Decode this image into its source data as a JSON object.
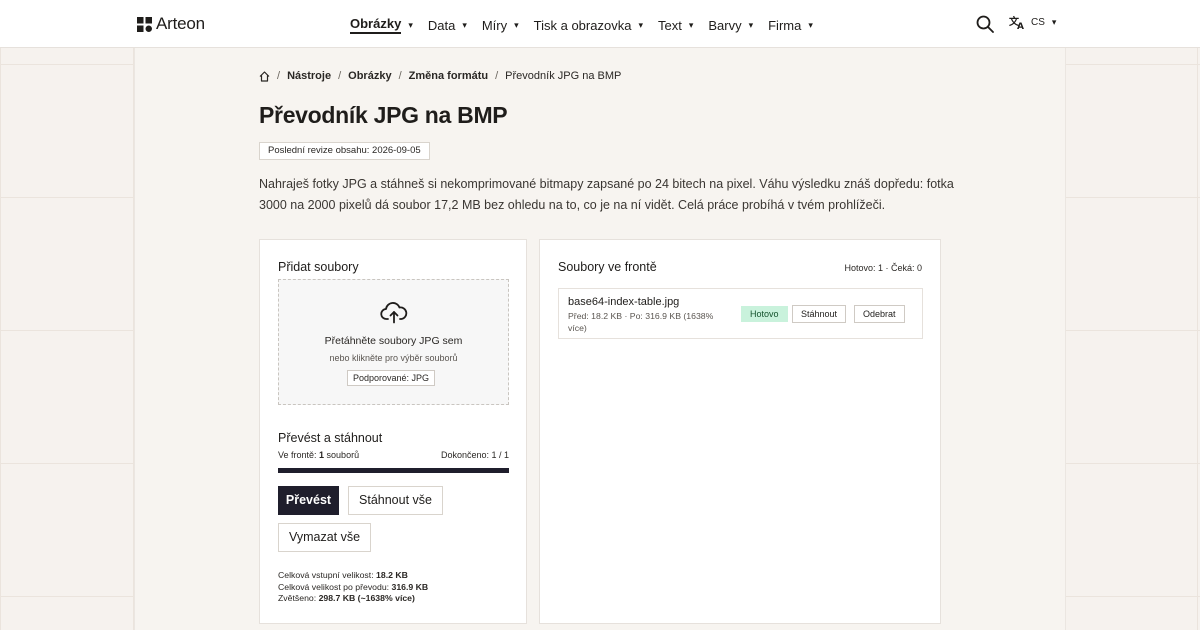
{
  "header": {
    "brand": "Arteon",
    "nav": [
      {
        "label": "Obrázky",
        "active": true
      },
      {
        "label": "Data"
      },
      {
        "label": "Míry"
      },
      {
        "label": "Tisk a obrazovka"
      },
      {
        "label": "Text"
      },
      {
        "label": "Barvy"
      },
      {
        "label": "Firma"
      }
    ],
    "language": "CS",
    "icons": {
      "search": "search-icon",
      "translate": "translate-icon",
      "caret": "▾"
    }
  },
  "breadcrumb": {
    "home_icon": "home-icon",
    "items": [
      "Nástroje",
      "Obrázky",
      "Změna formátu"
    ],
    "current": "Převodník JPG na BMP"
  },
  "page": {
    "title": "Převodník JPG na BMP",
    "revision": "Poslední revize obsahu: 2026-09-05",
    "intro": "Nahraješ fotky JPG a stáhneš si nekomprimované bitmapy zapsané po 24 bitech na pixel. Váhu výsledku znáš dopředu: fotka 3000 na 2000 pixelů dá soubor 17,2 MB bez ohledu na to, co je na ní vidět. Celá práce probíhá v tvém prohlížeči."
  },
  "upload": {
    "title": "Přidat soubory",
    "drop_main": "Přetáhněte soubory JPG sem",
    "drop_sub": "nebo klikněte pro výběr souborů",
    "supported": "Podporované: JPG",
    "icon": "cloud-upload-icon"
  },
  "convert": {
    "title": "Převést a stáhnout",
    "queue_prefix": "Ve frontě: ",
    "queue_count": "1",
    "queue_suffix": " souborů",
    "done_label": "Dokončeno: 1 / 1",
    "progress": 1.0,
    "convert_btn": "Převést",
    "download_all_btn": "Stáhnout vše",
    "clear_all_btn": "Vymazat vše"
  },
  "stats": {
    "input_label": "Celková vstupní velikost: ",
    "input_value": "18.2 KB",
    "output_label": "Celková velikost po převodu: ",
    "output_value": "316.9 KB",
    "growth_label": "Zvětšeno: ",
    "growth_value": "298.7 KB (~1638% více)"
  },
  "queue": {
    "title": "Soubory ve frontě",
    "counts": "Hotovo: 1 · Čeká: 0",
    "files": [
      {
        "name": "base64-index-table.jpg",
        "meta": "Před: 18.2 KB · Po: 316.9 KB (1638% více)",
        "status": "Hotovo",
        "download": "Stáhnout",
        "remove": "Odebrat"
      }
    ]
  },
  "colors": {
    "accent_dark": "#1f1e2c",
    "success_bg": "#c9f2dc",
    "page_bg": "#f6f2ee"
  }
}
